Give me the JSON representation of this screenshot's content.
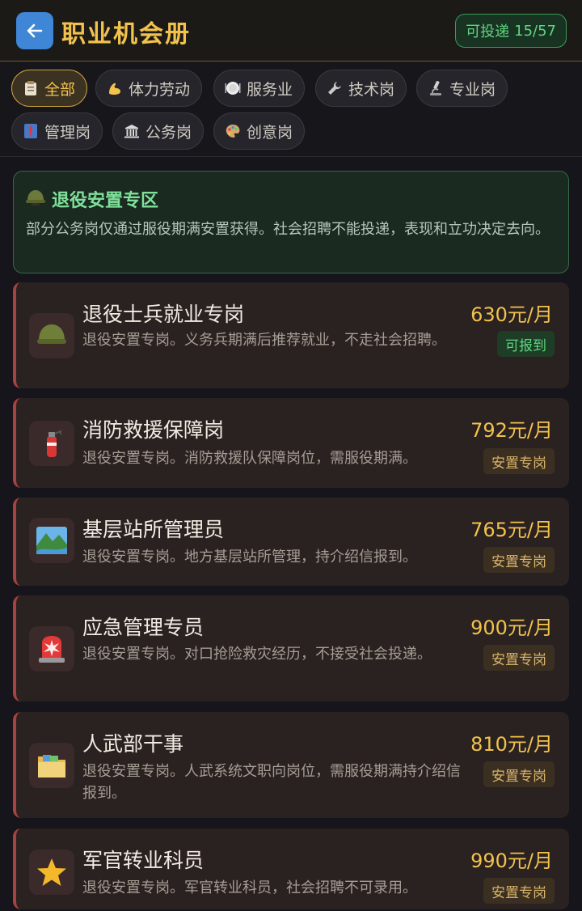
{
  "header": {
    "title": "职业机会册",
    "quota_label": "可投递",
    "quota_value": "15/57"
  },
  "filters": [
    {
      "label": "全部",
      "icon": "clipboard-icon",
      "active": true
    },
    {
      "label": "体力劳动",
      "icon": "flexed-bicep-icon",
      "active": false
    },
    {
      "label": "服务业",
      "icon": "plate-icon",
      "active": false
    },
    {
      "label": "技术岗",
      "icon": "wrench-icon",
      "active": false
    },
    {
      "label": "专业岗",
      "icon": "microscope-icon",
      "active": false
    },
    {
      "label": "管理岗",
      "icon": "necktie-icon",
      "active": false
    },
    {
      "label": "公务岗",
      "icon": "classical-building-icon",
      "active": false
    },
    {
      "label": "创意岗",
      "icon": "palette-icon",
      "active": false
    }
  ],
  "notice": {
    "icon": "military-helmet-icon",
    "title": "退役安置专区",
    "body": "部分公务岗仅通过服役期满安置获得。社会招聘不能投递，表现和立功决定去向。"
  },
  "jobs": [
    {
      "title": "退役士兵就业专岗",
      "desc": "退役安置专岗。义务兵期满后推荐就业，不走社会招聘。",
      "salary": "630元/月",
      "badge": "可报到",
      "badge_type": "ok",
      "icon": "military-helmet-icon"
    },
    {
      "title": "消防救援保障岗",
      "desc": "退役安置专岗。消防救援队保障岗位，需服役期满。",
      "salary": "792元/月",
      "badge": "安置专岗",
      "badge_type": "special",
      "icon": "fire-extinguisher-icon"
    },
    {
      "title": "基层站所管理员",
      "desc": "退役安置专岗。地方基层站所管理，持介绍信报到。",
      "salary": "765元/月",
      "badge": "安置专岗",
      "badge_type": "special",
      "icon": "national-park-icon"
    },
    {
      "title": "应急管理专员",
      "desc": "退役安置专岗。对口抢险救灾经历，不接受社会投递。",
      "salary": "900元/月",
      "badge": "安置专岗",
      "badge_type": "special",
      "icon": "rotating-light-icon"
    },
    {
      "title": "人武部干事",
      "desc": "退役安置专岗。人武系统文职向岗位，需服役期满持介绍信报到。",
      "salary": "810元/月",
      "badge": "安置专岗",
      "badge_type": "special",
      "icon": "file-folder-icon"
    },
    {
      "title": "军官转业科员",
      "desc": "退役安置专岗。军官转业科员，社会招聘不可录用。",
      "salary": "990元/月",
      "badge": "安置专岗",
      "badge_type": "special",
      "icon": "star-icon"
    }
  ],
  "colors": {
    "accent_gold": "#f2c24c",
    "ok_green": "#5fd47f",
    "card_border": "#a8423f",
    "back_button": "#3f86d6"
  }
}
